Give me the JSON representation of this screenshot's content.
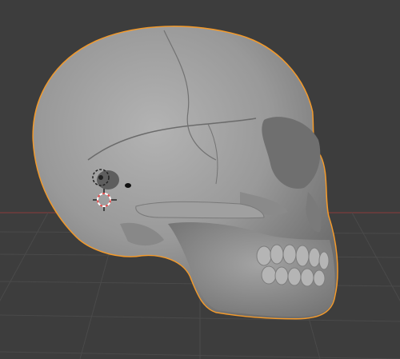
{
  "viewport": {
    "mode": "3D Viewport",
    "background_color": "#3d3d3d",
    "grid_color": "#4a4a4a",
    "x_axis_color": "#8b3a3a"
  },
  "selected_object": {
    "kind": "skull-mesh",
    "selected": true,
    "outline_color": "#f39a2b",
    "surface_color": "#9a9a9a"
  },
  "icons": {
    "origin": "object-origin-icon",
    "cursor": "3d-cursor-icon"
  }
}
